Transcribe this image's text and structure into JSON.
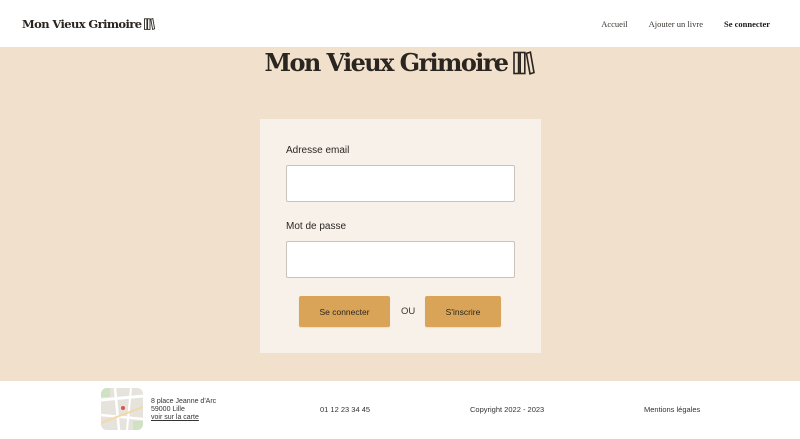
{
  "header": {
    "brand": "Mon Vieux Grimoire",
    "nav": [
      {
        "label": "Accueil",
        "active": false
      },
      {
        "label": "Ajouter un livre",
        "active": false
      },
      {
        "label": "Se connecter",
        "active": true
      }
    ]
  },
  "hero": {
    "title": "Mon Vieux Grimoire"
  },
  "login": {
    "email_label": "Adresse email",
    "email_value": "",
    "password_label": "Mot de passe",
    "password_value": "",
    "login_button": "Se connecter",
    "separator": "OU",
    "signup_button": "S'inscrire"
  },
  "footer": {
    "address_line1": "8 place Jeanne d'Arc",
    "address_line2": "59000 Lille",
    "map_link": "voir sur la carte",
    "phone": "01 12 23 34 45",
    "copyright": "Copyright 2022 - 2023",
    "legal": "Mentions légales"
  },
  "colors": {
    "page_background": "#f1e1cc",
    "card_background": "#f8f1ea",
    "button": "#d9a457",
    "text_dark": "#2b2520"
  },
  "icons": {
    "logo": "books-icon",
    "map_thumbnail": "map-icon"
  }
}
